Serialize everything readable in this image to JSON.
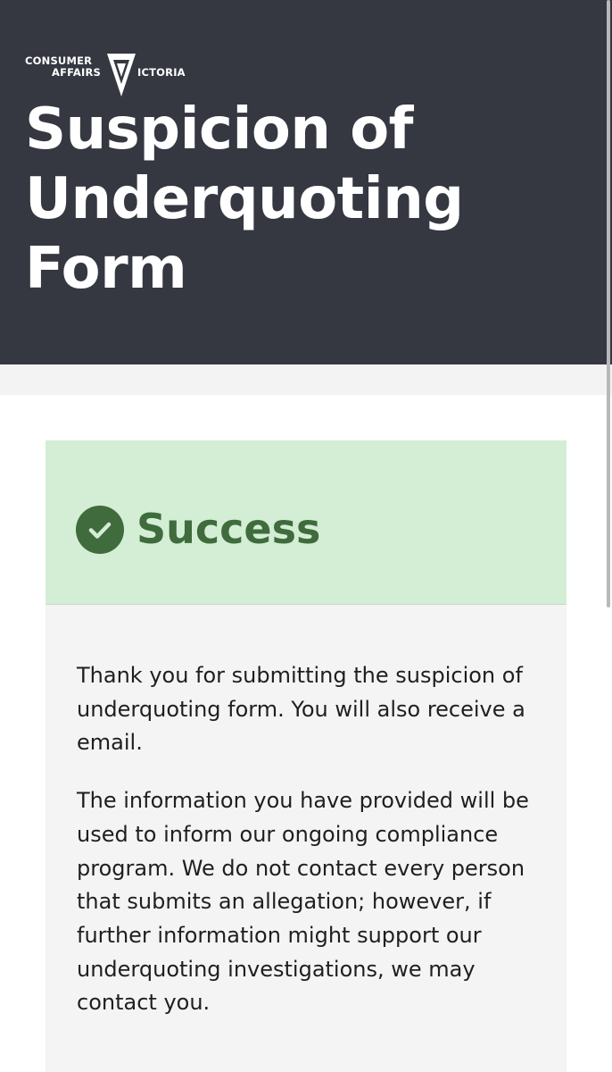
{
  "header": {
    "logo": {
      "line1": "CONSUMER",
      "line2": "AFFAIRS",
      "victoria_rest": "ICTORIA",
      "icon": "victoria-triangle-logo-icon"
    },
    "title": "Suspicion of\nUnderquoting\nForm"
  },
  "alert": {
    "icon": "check-circle-icon",
    "title": "Success",
    "paragraphs": [
      "Thank you for submitting the suspicion of underquoting form. You will also receive a email.",
      "The information you have provided will be used to inform our ongoing compliance program. We do not contact every person that submits an allegation; however, if further information might support our underquoting investigations, we may contact you."
    ]
  },
  "colors": {
    "header_bg": "#353741",
    "success_bg": "#d3eed4",
    "success_text": "#3f6b3d",
    "body_bg": "#f4f4f4"
  }
}
